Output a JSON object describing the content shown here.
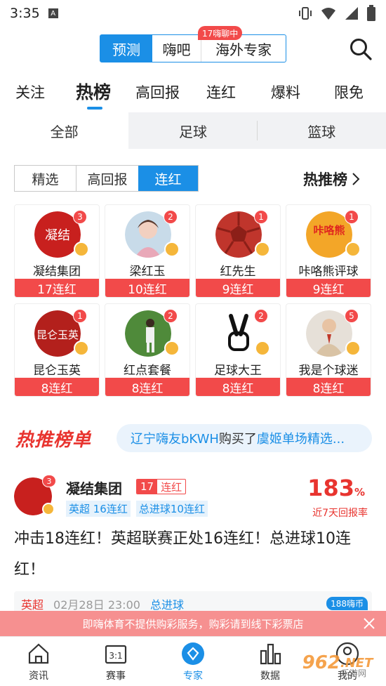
{
  "status_bar": {
    "time": "3:35",
    "a_icon": "A"
  },
  "top_segment": {
    "items": [
      "预测",
      "嗨吧",
      "海外专家"
    ],
    "active": "预测",
    "badge": "17嗨聊中"
  },
  "tabs": {
    "items": [
      "关注",
      "热榜",
      "高回报",
      "连红",
      "爆料",
      "限免"
    ],
    "active": "热榜"
  },
  "sub_tabs": {
    "items": [
      "全部",
      "足球",
      "篮球"
    ],
    "active": "全部"
  },
  "filter": {
    "items": [
      "精选",
      "高回报",
      "连红"
    ],
    "active": "连红"
  },
  "hot_link": {
    "label": "热推榜"
  },
  "experts": [
    {
      "name": "凝结集团",
      "streak": "17连红",
      "rank": "3",
      "avatar": "text-seal-avatar",
      "color": "#c8201e",
      "avatar_text": "凝结"
    },
    {
      "name": "梁红玉",
      "streak": "10连红",
      "rank": "2",
      "avatar": "girl-avatar",
      "color": "#c8dbe9",
      "avatar_text": ""
    },
    {
      "name": "红先生",
      "streak": "9连红",
      "rank": "1",
      "avatar": "red-ball-avatar",
      "color": "#c0352c",
      "avatar_text": ""
    },
    {
      "name": "咔咯熊评球",
      "streak": "9连红",
      "rank": "1",
      "avatar": "bear-logo-avatar",
      "color": "#f3a628",
      "avatar_text": "咔咯熊"
    },
    {
      "name": "昆仑玉英",
      "streak": "8连红",
      "rank": "1",
      "avatar": "seal-avatar",
      "color": "#b3201c",
      "avatar_text": "昆仑玉英"
    },
    {
      "name": "红点套餐",
      "streak": "8连红",
      "rank": "2",
      "avatar": "player-avatar",
      "color": "#4f8a3a",
      "avatar_text": ""
    },
    {
      "name": "足球大王",
      "streak": "8连红",
      "rank": "2",
      "avatar": "victory-hand-avatar",
      "color": "#ffffff",
      "avatar_text": ""
    },
    {
      "name": "我是个球迷",
      "streak": "8连红",
      "rank": "5",
      "avatar": "man-avatar",
      "color": "#d9c3a5",
      "avatar_text": ""
    }
  ],
  "hot_list": {
    "title": "热推榜单",
    "ticker": {
      "user": "辽宁嗨友bKWH",
      "action": "购买了",
      "item": "虞姬单场精选..."
    }
  },
  "post": {
    "name": "凝结集团",
    "rank": "3",
    "badge_num": "17",
    "badge_text": "连红",
    "tags": [
      "英超 16连红",
      "总进球10连红"
    ],
    "rate": "183",
    "rate_unit": "%",
    "rate_label": "近7天回报率",
    "text": "冲击18连红！英超联赛正处16连红！总进球10连红！"
  },
  "match": {
    "league": "英超",
    "time": "02月28日 23:00",
    "bet": "总进球",
    "hot": "188嗨币"
  },
  "notice": {
    "text": "即嗨体育不提供购彩服务，购彩请到线下彩票店"
  },
  "bottom_nav": {
    "items": [
      "资讯",
      "赛事",
      "专家",
      "数据",
      "我的"
    ],
    "active": "专家"
  },
  "watermark": {
    "brand": "962",
    "sub": ".NET",
    "site": "乐游网"
  },
  "colors": {
    "accent": "#1b8fe6",
    "red": "#f24a4a",
    "notice_bg": "#f69090"
  }
}
